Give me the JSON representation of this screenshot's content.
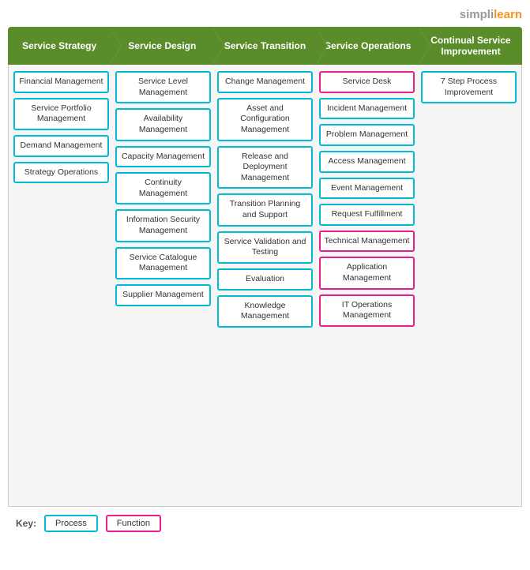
{
  "logo": {
    "simpli": "simpli",
    "learn": "learn"
  },
  "headers": [
    {
      "id": "service-strategy",
      "label": "Service Strategy"
    },
    {
      "id": "service-design",
      "label": "Service Design"
    },
    {
      "id": "service-transition",
      "label": "Service Transition"
    },
    {
      "id": "service-operations",
      "label": "Service Operations"
    },
    {
      "id": "continual-service",
      "label": "Continual Service Improvement"
    }
  ],
  "columns": [
    {
      "id": "strategy",
      "items": [
        {
          "label": "Financial Management",
          "type": "process"
        },
        {
          "label": "Service Portfolio Management",
          "type": "process"
        },
        {
          "label": "Demand Management",
          "type": "process"
        },
        {
          "label": "Strategy Operations",
          "type": "process"
        }
      ]
    },
    {
      "id": "design",
      "items": [
        {
          "label": "Service Level Management",
          "type": "process"
        },
        {
          "label": "Availability Management",
          "type": "process"
        },
        {
          "label": "Capacity Management",
          "type": "process"
        },
        {
          "label": "Continuity Management",
          "type": "process"
        },
        {
          "label": "Information Security Management",
          "type": "process"
        },
        {
          "label": "Service Catalogue Management",
          "type": "process"
        },
        {
          "label": "Supplier Management",
          "type": "process"
        }
      ]
    },
    {
      "id": "transition",
      "items": [
        {
          "label": "Change Management",
          "type": "process"
        },
        {
          "label": "Asset and Configuration Management",
          "type": "process"
        },
        {
          "label": "Release and Deployment Management",
          "type": "process"
        },
        {
          "label": "Transition Planning and Support",
          "type": "process"
        },
        {
          "label": "Service Validation and Testing",
          "type": "process"
        },
        {
          "label": "Evaluation",
          "type": "process"
        },
        {
          "label": "Knowledge Management",
          "type": "process"
        }
      ]
    },
    {
      "id": "operations",
      "items": [
        {
          "label": "Service Desk",
          "type": "function"
        },
        {
          "label": "Incident Management",
          "type": "process"
        },
        {
          "label": "Problem Management",
          "type": "process"
        },
        {
          "label": "Access Management",
          "type": "process"
        },
        {
          "label": "Event Management",
          "type": "process"
        },
        {
          "label": "Request Fulfillment",
          "type": "process"
        },
        {
          "label": "Technical Management",
          "type": "function"
        },
        {
          "label": "Application Management",
          "type": "function"
        },
        {
          "label": "IT Operations Management",
          "type": "function"
        }
      ]
    },
    {
      "id": "csi",
      "items": [
        {
          "label": "7 Step Process Improvement",
          "type": "process"
        }
      ]
    }
  ],
  "key": {
    "label": "Key:",
    "process_label": "Process",
    "function_label": "Function"
  }
}
